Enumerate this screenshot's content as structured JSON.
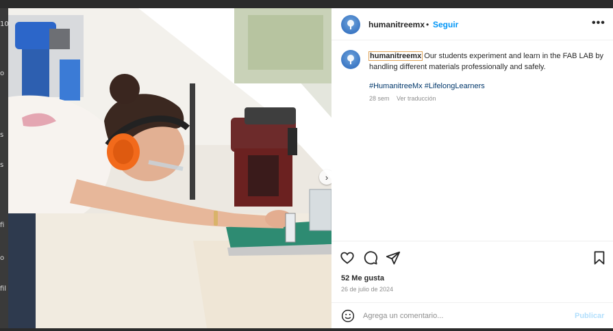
{
  "left_strip": {
    "fragments": [
      "10",
      "o",
      "s",
      "s",
      "fi",
      "o",
      "fil"
    ]
  },
  "post": {
    "username": "humanitreemx",
    "dot": "•",
    "follow_label": "Seguir",
    "more_icon": "more-horizontal-icon",
    "caption_user": "humanitreemx",
    "caption_text": " Our students experiment and learn in the FAB LAB by handling different materials professionally and safely.",
    "hashtags": [
      "#HumanitreeMx",
      "#LifelongLearners"
    ],
    "time_ago": "28 sem",
    "translate_label": "Ver traducción",
    "likes": "52 Me gusta",
    "date": "26 de julio de 2024",
    "comment_placeholder": "Agrega un comentario...",
    "publish_label": "Publicar"
  },
  "icons": {
    "like": "heart-icon",
    "comment": "comment-icon",
    "share": "send-icon",
    "save": "bookmark-icon",
    "emoji": "emoji-icon",
    "carousel_next": "chevron-right-icon"
  },
  "colors": {
    "follow": "#0095f6",
    "hashtag": "#00376b",
    "muted": "#8e8e8e",
    "text": "#262626",
    "publish_disabled": "#b2dffc"
  }
}
